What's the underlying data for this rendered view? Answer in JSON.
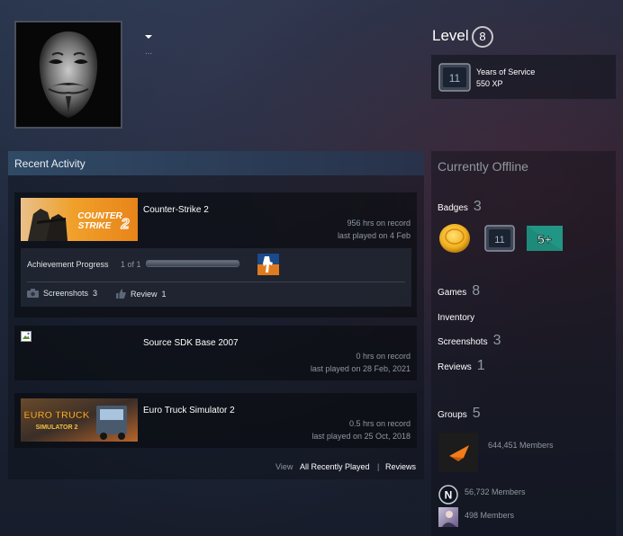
{
  "profile": {
    "name_dots": "..."
  },
  "level": {
    "label": "Level",
    "value": "8"
  },
  "featured_badge": {
    "title": "Years of Service",
    "xp": "550 XP",
    "icon_text": "11"
  },
  "recent_activity": {
    "header": "Recent Activity",
    "games": [
      {
        "name": "Counter-Strike 2",
        "capsule_text": [
          "COUNTER",
          "STRIKE"
        ],
        "hours": "956 hrs on record",
        "last_played": "last played on 4 Feb",
        "achievement": {
          "label": "Achievement Progress",
          "count": "1 of 1",
          "progress": 1.0
        },
        "screenshots_label": "Screenshots",
        "screenshots_count": "3",
        "review_label": "Review",
        "review_count": "1"
      },
      {
        "name": "Source SDK Base 2007",
        "hours": "0 hrs on record",
        "last_played": "last played on 28 Feb, 2021"
      },
      {
        "name": "Euro Truck Simulator 2",
        "capsule_text": [
          "EURO TRUCK",
          "SIMULATOR 2"
        ],
        "hours": "0.5 hrs on record",
        "last_played": "last played on 25 Oct, 2018"
      }
    ],
    "footer": {
      "view": "View",
      "all": "All Recently Played",
      "sep": "|",
      "reviews": "Reviews"
    }
  },
  "sidebar": {
    "status": "Currently Offline",
    "badges": {
      "label": "Badges",
      "count": "3",
      "yos_text": "11",
      "plus_text": "5+"
    },
    "games": {
      "label": "Games",
      "count": "8"
    },
    "inventory": {
      "label": "Inventory"
    },
    "screenshots": {
      "label": "Screenshots",
      "count": "3"
    },
    "reviews": {
      "label": "Reviews",
      "count": "1"
    },
    "groups": {
      "label": "Groups",
      "count": "5",
      "items": [
        {
          "members": "644,451 Members"
        },
        {
          "members": "56,732 Members",
          "icon_text": "N"
        },
        {
          "members": "498 Members"
        }
      ]
    }
  },
  "colors": {
    "link": "#ffffff",
    "muted": "#8f98a0",
    "accent_orange": "#f27b1a",
    "header_blue": "#304a66"
  }
}
